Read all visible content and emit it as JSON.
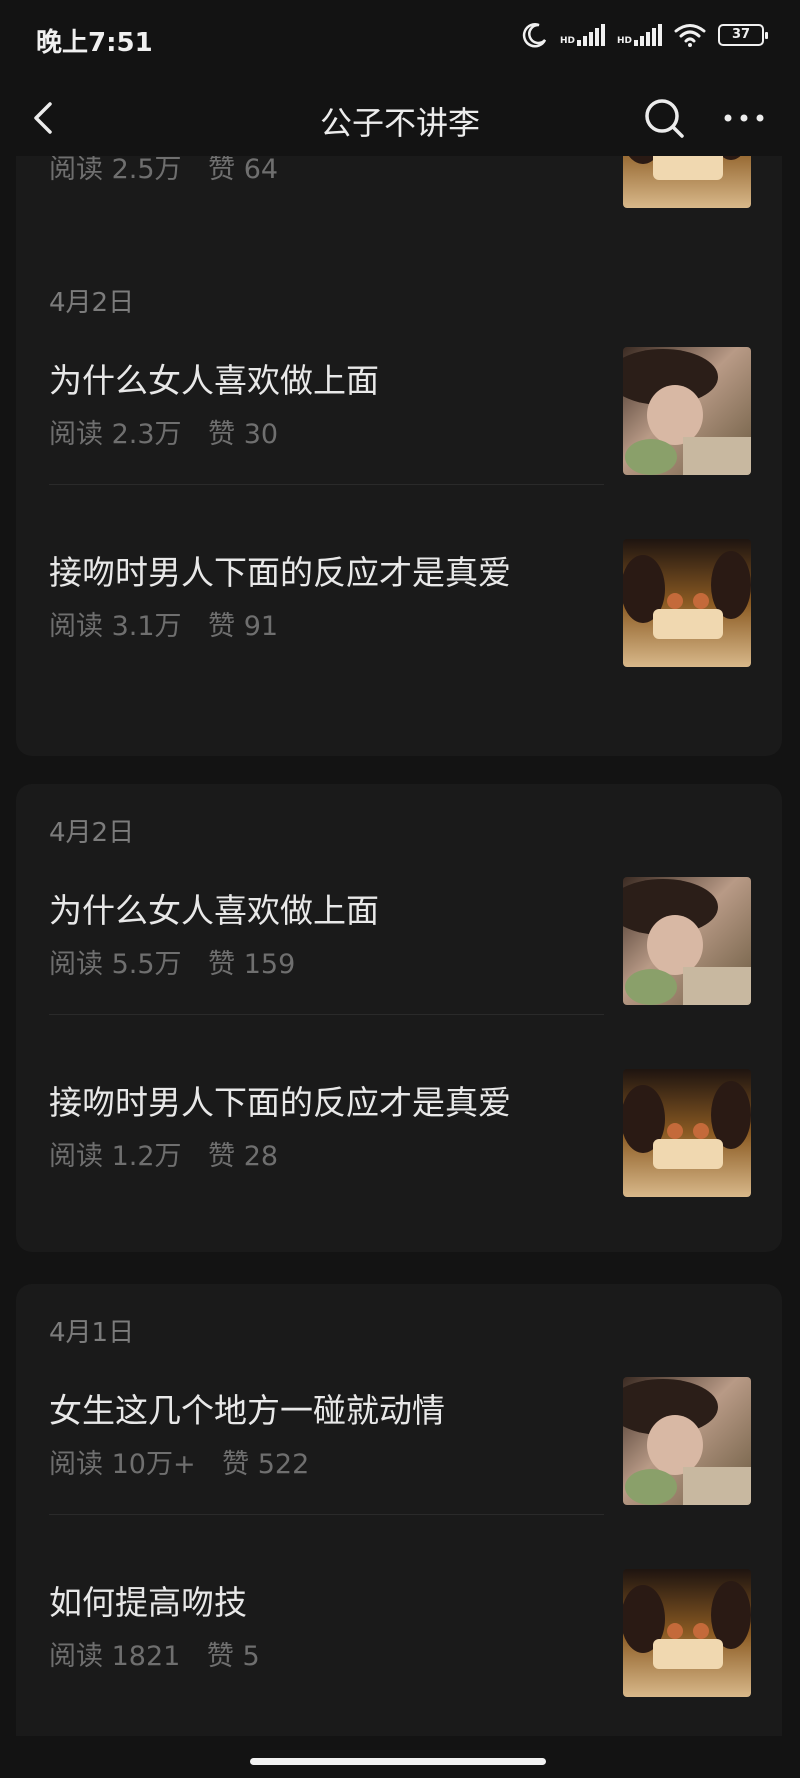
{
  "status_bar": {
    "time": "晚上7:51",
    "battery": "37",
    "hd_label": "HD"
  },
  "header": {
    "title": "公子不讲李"
  },
  "partial_top": {
    "reads": "阅读 2.5万",
    "likes": "赞 64"
  },
  "groups": [
    {
      "date": "4月2日",
      "articles": [
        {
          "title": "为什么女人喜欢做上面",
          "reads": "阅读 2.3万",
          "likes": "赞 30"
        },
        {
          "title": "接吻时男人下面的反应才是真爱",
          "reads": "阅读 3.1万",
          "likes": "赞 91"
        }
      ]
    },
    {
      "date": "4月2日",
      "articles": [
        {
          "title": "为什么女人喜欢做上面",
          "reads": "阅读 5.5万",
          "likes": "赞 159"
        },
        {
          "title": "接吻时男人下面的反应才是真爱",
          "reads": "阅读 1.2万",
          "likes": "赞 28"
        }
      ]
    },
    {
      "date": "4月1日",
      "articles": [
        {
          "title": "女生这几个地方一碰就动情",
          "reads": "阅读 10万+",
          "likes": "赞 522"
        },
        {
          "title": "如何提高吻技",
          "reads": "阅读 1821",
          "likes": "赞 5"
        }
      ]
    }
  ]
}
